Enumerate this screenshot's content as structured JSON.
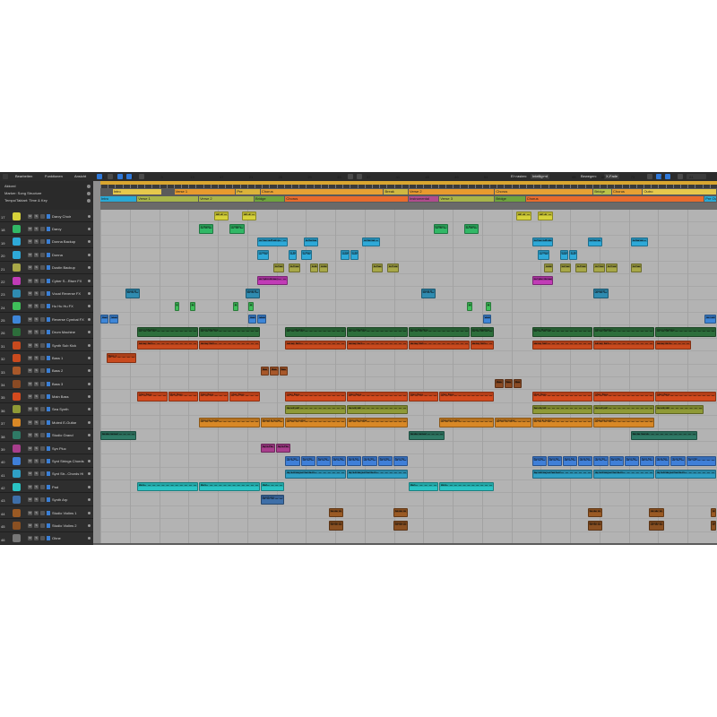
{
  "toolbar": {
    "edit_menu": "Bearbeiten",
    "functions_menu": "Funktionen",
    "view_menu": "Ansicht",
    "snap_label": "Einrasten:",
    "snap_value": "Intelligent",
    "drag_label": "Bewegen:",
    "drag_value": "X-Fade"
  },
  "globals": {
    "rows": [
      "Akkord",
      "Marker: Song Structure",
      "Tempo/Taktart: Time & Key"
    ]
  },
  "ruler": {
    "numbers": [
      "1",
      "5",
      "9",
      "13",
      "17",
      "21",
      "25",
      "29",
      "33",
      "37",
      "41",
      "45",
      "49",
      "53",
      "57",
      "61",
      "65",
      "69",
      "73",
      "77",
      "81"
    ]
  },
  "markers": [
    {
      "label": "Intro",
      "color": "#e6c84c"
    },
    {
      "label": "Verse 1",
      "color": "#e89a2e"
    },
    {
      "label": "Pre",
      "color": "#dbb23a"
    },
    {
      "label": "Chorus",
      "color": "#e7a134"
    },
    {
      "label": "Break",
      "color": "#d0b841"
    },
    {
      "label": "Verse 2",
      "color": "#e89a2e"
    },
    {
      "label": "Chorus",
      "color": "#e7a134"
    },
    {
      "label": "Bridge",
      "color": "#b9c248"
    },
    {
      "label": "Chorus",
      "color": "#e7a134"
    },
    {
      "label": "Outro",
      "color": "#e6c84c"
    }
  ],
  "arrangement": [
    {
      "label": "Intro",
      "color": "#2aa9d5"
    },
    {
      "label": "Verse 1",
      "color": "#a8b54a"
    },
    {
      "label": "Verse 2",
      "color": "#a8b54a"
    },
    {
      "label": "Bridge",
      "color": "#6fa43e"
    },
    {
      "label": "Chorus",
      "color": "#e96b2d"
    },
    {
      "label": "Instrumental",
      "color": "#b04c8e"
    },
    {
      "label": "Verse 3",
      "color": "#a8b54a"
    },
    {
      "label": "Bridge",
      "color": "#6fa43e"
    },
    {
      "label": "Chorus",
      "color": "#e96b2d"
    },
    {
      "label": "Pre Outro",
      "color": "#2aa9d5"
    }
  ],
  "tracks": [
    {
      "num": "17",
      "name": "Darcy Choir",
      "color": "#d6d23a"
    },
    {
      "num": "18",
      "name": "Darcy",
      "color": "#31b866"
    },
    {
      "num": "19",
      "name": "Donna Backup",
      "color": "#2ea9d8"
    },
    {
      "num": "20",
      "name": "Donna",
      "color": "#2ea9d8"
    },
    {
      "num": "21",
      "name": "Dustin Backup",
      "color": "#a8a848"
    },
    {
      "num": "22",
      "name": "Cyber S...Riser FX",
      "color": "#c13bb6"
    },
    {
      "num": "23",
      "name": "Vocal Reverse FX",
      "color": "#2f8bb0"
    },
    {
      "num": "24",
      "name": "Hu Hu Hu FX",
      "color": "#3fbf5a"
    },
    {
      "num": "25",
      "name": "Reverse Cymbal FX",
      "color": "#3e86d8"
    },
    {
      "num": "26",
      "name": "Drum Machine",
      "color": "#2d6e3b"
    },
    {
      "num": "31",
      "name": "Synth Sub Kick",
      "color": "#c94a1e"
    },
    {
      "num": "32",
      "name": "Bass 1",
      "color": "#c94a1e"
    },
    {
      "num": "33",
      "name": "Bass 2",
      "color": "#a8582a"
    },
    {
      "num": "34",
      "name": "Bass 3",
      "color": "#8a4a24"
    },
    {
      "num": "35",
      "name": "Main Bass",
      "color": "#d44a1e"
    },
    {
      "num": "36",
      "name": "Sea Synth",
      "color": "#8f9a36"
    },
    {
      "num": "37",
      "name": "Muted E-Guitar",
      "color": "#d88826"
    },
    {
      "num": "38",
      "name": "Studio Grand",
      "color": "#2f7a66"
    },
    {
      "num": "39",
      "name": "Syn Pluc",
      "color": "#a83e8c"
    },
    {
      "num": "40",
      "name": "Synt Strings Chords",
      "color": "#3f7fd8"
    },
    {
      "num": "41",
      "name": "Synt Str...Chords Hi",
      "color": "#2f9fc4"
    },
    {
      "num": "42",
      "name": "Pad",
      "color": "#2ac4c4"
    },
    {
      "num": "43",
      "name": "Synth Arp",
      "color": "#3e6fa8"
    },
    {
      "num": "44",
      "name": "Studio Violins 1",
      "color": "#9a5a24"
    },
    {
      "num": "45",
      "name": "Studio Violins 2",
      "color": "#8a5022"
    },
    {
      "num": "46",
      "name": "Ohne",
      "color": "#777777"
    }
  ],
  "region_labels": {
    "darcy_choir": "Ch. Ir",
    "darcy": "C Darcy",
    "donna_backup": "C Donna Backup",
    "donna": "C Donna",
    "cyber": "C Cyber Sweep",
    "vocal_fx": "Vocal R",
    "drum": "Drum Machine",
    "kick": "Heavy Kick",
    "bass1": "Bass 1",
    "bass": "Bas",
    "main_bass": "Main Bass",
    "sea": "Sea Synth",
    "guitar": "Muted E-Guitar",
    "grand": "Studio Grand",
    "pluc": "Synt Plu",
    "strings": "Synt Str",
    "strings_hi": "Synt Strings Chords Hi",
    "pad": "Pad",
    "arp": "Synth Arp",
    "violins": "Studio Vi"
  }
}
